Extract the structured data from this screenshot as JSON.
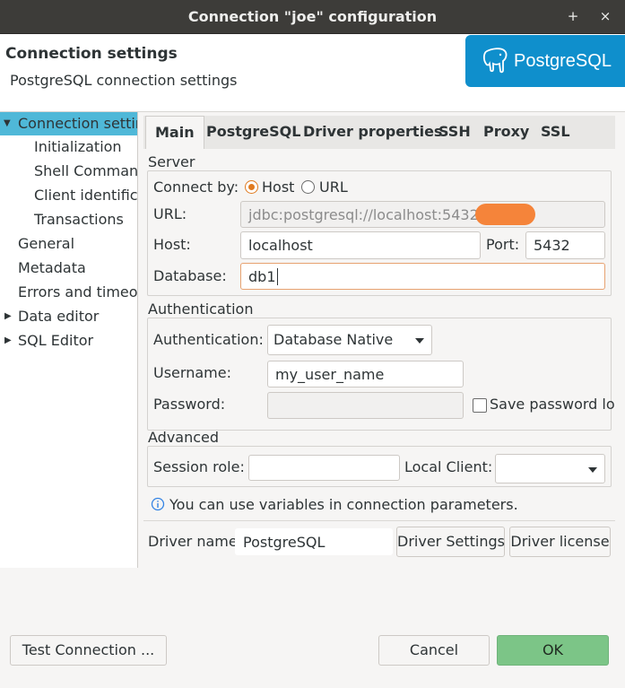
{
  "window": {
    "title": "Connection \"joe\" configuration",
    "btn_plus": "+",
    "btn_close": "×"
  },
  "header": {
    "title": "Connection settings",
    "subtitle": "PostgreSQL connection settings",
    "logo_text": "PostgreSQL"
  },
  "tree": {
    "items": [
      {
        "label": "Connection settings",
        "expanded": true,
        "selected": true
      },
      {
        "label": "Initialization"
      },
      {
        "label": "Shell Commands"
      },
      {
        "label": "Client identification"
      },
      {
        "label": "Transactions"
      },
      {
        "label": "General"
      },
      {
        "label": "Metadata"
      },
      {
        "label": "Errors and timeouts"
      },
      {
        "label": "Data editor",
        "collapsed": true
      },
      {
        "label": "SQL Editor",
        "collapsed": true
      }
    ]
  },
  "tabs": [
    "Main",
    "PostgreSQL",
    "Driver properties",
    "SSH",
    "Proxy",
    "SSL"
  ],
  "server": {
    "group_title": "Server",
    "connect_by_label": "Connect by:",
    "host_option": "Host",
    "url_option": "URL",
    "url_label": "URL:",
    "url_value": "jdbc:postgresql://localhost:5432/",
    "host_label": "Host:",
    "host_value": "localhost",
    "port_label": "Port:",
    "port_value": "5432",
    "database_label": "Database:",
    "database_value": "db1"
  },
  "auth": {
    "group_title": "Authentication",
    "auth_label": "Authentication:",
    "auth_value": "Database Native",
    "username_label": "Username:",
    "username_value": "my_user_name",
    "password_label": "Password:",
    "password_value": "",
    "save_password_label": "Save password lo"
  },
  "advanced": {
    "group_title": "Advanced",
    "session_role_label": "Session role:",
    "session_role_value": "",
    "local_client_label": "Local Client:",
    "local_client_value": ""
  },
  "info_text": "You can use variables in connection parameters.",
  "driver": {
    "name_label": "Driver name:",
    "name_value": "PostgreSQL",
    "settings_button": "Driver Settings",
    "license_button": "Driver license"
  },
  "footer": {
    "test_button": "Test Connection ...",
    "cancel_button": "Cancel",
    "ok_button": "OK"
  },
  "colors": {
    "accent_orange": "#e07a1f",
    "selection": "#4fb8d8",
    "ok_button": "#7cc587",
    "logo_bg": "#0f8fcc"
  }
}
